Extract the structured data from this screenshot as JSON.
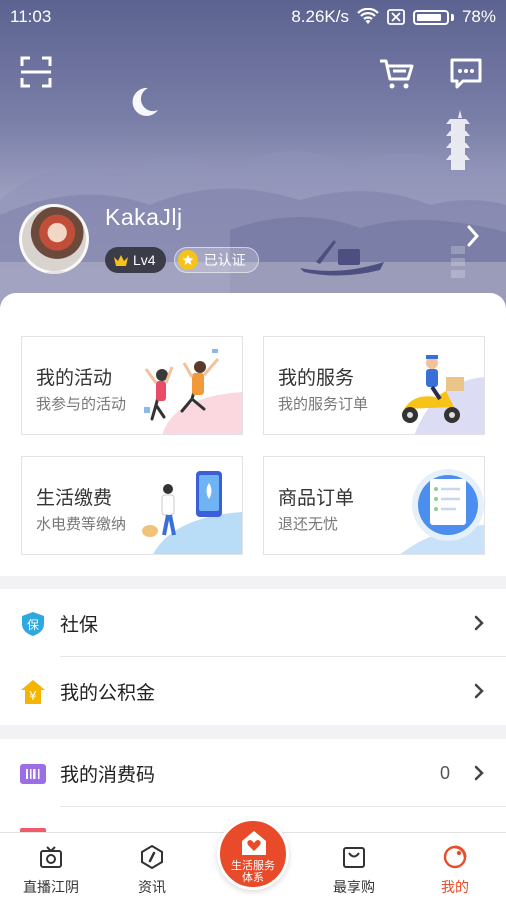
{
  "status_bar": {
    "time": "11:03",
    "speed": "8.26K/s",
    "battery": "78%",
    "icons": [
      "wifi-icon",
      "sim-card-off-icon",
      "battery-icon"
    ]
  },
  "header": {
    "left_icon": "scan-icon",
    "right_icons": [
      "cart-icon",
      "message-icon"
    ],
    "username": "KakaJlj",
    "level_badge": "Lv4",
    "verified_badge": "已认证"
  },
  "cards": [
    {
      "title": "我的活动",
      "subtitle": "我参与的活动",
      "art": "people-celebrating-illustration"
    },
    {
      "title": "我的服务",
      "subtitle": "我的服务订单",
      "art": "delivery-scooter-illustration"
    },
    {
      "title": "生活缴费",
      "subtitle": "水电费等缴纳",
      "art": "phone-payment-illustration"
    },
    {
      "title": "商品订单",
      "subtitle": "退还无忧",
      "art": "order-document-illustration"
    }
  ],
  "list_group_1": [
    {
      "label": "社保",
      "icon": "shield-icon",
      "icon_text": "保",
      "icon_color": "#2fa8e0"
    },
    {
      "label": "我的公积金",
      "icon": "house-coin-icon",
      "icon_text": "¥",
      "icon_color": "#f5b400"
    }
  ],
  "list_group_2": [
    {
      "label": "我的消费码",
      "icon": "barcode-ticket-icon",
      "value": "0",
      "icon_color": "#9b6ee8"
    }
  ],
  "bottom_nav": {
    "items": [
      {
        "label": "直播江阴",
        "icon": "live-tv-icon"
      },
      {
        "label": "资讯",
        "icon": "compass-icon"
      },
      {
        "label": "最享购",
        "icon": "shopping-bag-icon"
      },
      {
        "label": "我的",
        "icon": "profile-circle-icon"
      }
    ],
    "center_label_line1": "生活服务",
    "center_label_line2": "体系",
    "active_color": "#e84c2b"
  }
}
